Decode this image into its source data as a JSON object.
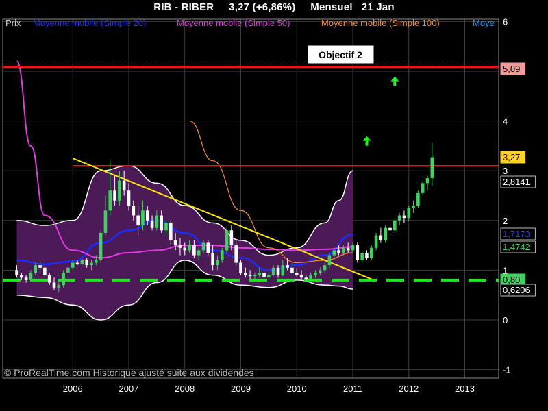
{
  "header": {
    "symbol": "RIB - RIBER",
    "last": "3,27 (+6,86%)",
    "period": "Mensuel",
    "date": "21 Jan"
  },
  "legend": {
    "prix": "Prix",
    "ma20": "Moyenne mobile (Simple 20)",
    "ma50": "Moyenne mobile (Simple 50)",
    "ma100": "Moyenne mobile (Simple 100)",
    "ma_more": "Moye"
  },
  "colors": {
    "background": "#000000",
    "grid": "#3c3c3c",
    "candle_up": "#3ed35e",
    "candle_down": "#ffffff",
    "bollinger_fill": "#4b1a57",
    "bollinger_line": "#ffffff",
    "ma20": "#1a2cff",
    "ma50": "#e43ae4",
    "ma100": "#ff8c1a",
    "trendline": "#ffe600",
    "resistance": "#e01b1b",
    "support": "#22e622",
    "signal_arrow": "#22ee22"
  },
  "annotations": {
    "objective_label": "Objectif 2",
    "objective_level": "5,09",
    "resistance_level": "3,10",
    "support_level": "0,80",
    "watermark": "© ProRealTime.com Historique ajusté suite aux dividendes"
  },
  "price_tags": [
    {
      "text": "5,09",
      "value": 5.09,
      "bg": "#f19a9a",
      "fg": "#000000"
    },
    {
      "text": "3,27",
      "value": 3.27,
      "bg": "#ffd21f",
      "fg": "#000000"
    },
    {
      "text": "2,8141",
      "value": 2.81,
      "bg": "#000000",
      "fg": "#ffffff"
    },
    {
      "text": "1,7173",
      "value": 1.72,
      "bg": "#000000",
      "fg": "#2e3cff"
    },
    {
      "text": "1,4742",
      "value": 1.47,
      "bg": "#000000",
      "fg": "#3ed35e"
    },
    {
      "text": "0,80",
      "value": 0.8,
      "bg": "#3ed35e",
      "fg": "#000000"
    },
    {
      "text": "0,6206",
      "value": 0.62,
      "bg": "#000000",
      "fg": "#ffffff"
    }
  ],
  "chart_data": {
    "type": "candlestick",
    "title": "RIB - RIBER 3,27 (+6,86%) Mensuel 21 Jan",
    "ylim": [
      -1,
      6.2
    ],
    "y_ticks": [
      "-1",
      "0",
      "1",
      "2",
      "3",
      "4",
      "5",
      "6"
    ],
    "y_tick_values": [
      -1,
      0,
      1,
      2,
      3,
      4,
      5,
      6
    ],
    "x_ticks": [
      "2006",
      "2007",
      "2008",
      "2009",
      "2010",
      "2011",
      "2012",
      "2013"
    ],
    "x_start": "2005-01",
    "grid": true,
    "legend_position": "top-left",
    "ohlc": [
      [
        1.0,
        1.1,
        0.85,
        0.9
      ],
      [
        0.9,
        0.95,
        0.8,
        0.85
      ],
      [
        0.85,
        0.9,
        0.75,
        0.8
      ],
      [
        0.8,
        1.0,
        0.78,
        0.95
      ],
      [
        0.95,
        1.15,
        0.9,
        1.1
      ],
      [
        1.1,
        1.2,
        1.0,
        1.05
      ],
      [
        1.05,
        1.1,
        0.85,
        0.9
      ],
      [
        0.9,
        0.95,
        0.7,
        0.75
      ],
      [
        0.75,
        0.85,
        0.6,
        0.65
      ],
      [
        0.65,
        0.75,
        0.55,
        0.7
      ],
      [
        0.7,
        1.0,
        0.65,
        0.95
      ],
      [
        0.95,
        1.1,
        0.9,
        1.05
      ],
      [
        1.05,
        1.2,
        1.0,
        1.15
      ],
      [
        1.15,
        1.2,
        1.1,
        1.12
      ],
      [
        1.12,
        1.25,
        1.1,
        1.2
      ],
      [
        1.2,
        1.25,
        1.05,
        1.1
      ],
      [
        1.1,
        1.2,
        1.0,
        1.15
      ],
      [
        1.15,
        1.3,
        1.1,
        1.2
      ],
      [
        1.2,
        1.8,
        1.15,
        1.75
      ],
      [
        1.75,
        2.5,
        1.7,
        2.2
      ],
      [
        2.2,
        3.2,
        2.1,
        2.6
      ],
      [
        2.6,
        2.9,
        2.3,
        2.4
      ],
      [
        2.4,
        3.0,
        2.3,
        2.8
      ],
      [
        2.8,
        3.0,
        2.5,
        2.6
      ],
      [
        2.6,
        2.75,
        2.2,
        2.3
      ],
      [
        2.3,
        2.4,
        2.0,
        2.1
      ],
      [
        2.1,
        2.3,
        1.7,
        1.9
      ],
      [
        1.9,
        2.4,
        1.8,
        2.2
      ],
      [
        2.2,
        2.3,
        1.9,
        2.0
      ],
      [
        2.0,
        2.1,
        1.8,
        1.85
      ],
      [
        1.85,
        2.2,
        1.8,
        2.1
      ],
      [
        2.1,
        2.2,
        1.75,
        1.8
      ],
      [
        1.8,
        2.0,
        1.7,
        1.95
      ],
      [
        1.95,
        2.0,
        1.5,
        1.6
      ],
      [
        1.6,
        1.75,
        1.4,
        1.5
      ],
      [
        1.5,
        1.65,
        1.3,
        1.45
      ],
      [
        1.45,
        1.55,
        1.3,
        1.4
      ],
      [
        1.4,
        1.6,
        1.35,
        1.5
      ],
      [
        1.5,
        1.6,
        1.25,
        1.3
      ],
      [
        1.3,
        1.45,
        1.2,
        1.4
      ],
      [
        1.4,
        1.6,
        1.35,
        1.55
      ],
      [
        1.55,
        1.6,
        1.3,
        1.35
      ],
      [
        1.35,
        1.5,
        1.0,
        1.1
      ],
      [
        1.1,
        1.3,
        1.0,
        1.2
      ],
      [
        1.2,
        1.45,
        1.15,
        1.4
      ],
      [
        1.4,
        1.85,
        1.35,
        1.8
      ],
      [
        1.8,
        1.9,
        1.4,
        1.5
      ],
      [
        1.5,
        1.6,
        1.1,
        1.15
      ],
      [
        1.15,
        1.2,
        0.9,
        0.95
      ],
      [
        0.95,
        1.05,
        0.85,
        0.9
      ],
      [
        0.9,
        1.0,
        0.82,
        0.88
      ],
      [
        0.88,
        0.95,
        0.82,
        0.9
      ],
      [
        0.9,
        1.05,
        0.85,
        0.95
      ],
      [
        0.95,
        1.0,
        0.82,
        0.86
      ],
      [
        0.86,
        0.95,
        0.8,
        0.9
      ],
      [
        0.9,
        1.1,
        0.88,
        1.05
      ],
      [
        1.05,
        1.1,
        0.85,
        0.9
      ],
      [
        0.9,
        1.2,
        0.88,
        1.1
      ],
      [
        1.1,
        1.25,
        1.0,
        1.05
      ],
      [
        1.05,
        1.15,
        0.9,
        0.95
      ],
      [
        0.95,
        1.05,
        0.85,
        0.9
      ],
      [
        0.9,
        1.0,
        0.82,
        0.85
      ],
      [
        0.85,
        0.9,
        0.78,
        0.82
      ],
      [
        0.82,
        0.95,
        0.8,
        0.9
      ],
      [
        0.9,
        1.0,
        0.85,
        0.95
      ],
      [
        0.95,
        1.05,
        0.9,
        1.0
      ],
      [
        1.0,
        1.15,
        0.95,
        1.1
      ],
      [
        1.1,
        1.35,
        1.05,
        1.3
      ],
      [
        1.3,
        1.45,
        1.25,
        1.4
      ],
      [
        1.4,
        1.5,
        1.3,
        1.35
      ],
      [
        1.35,
        1.5,
        1.3,
        1.45
      ],
      [
        1.45,
        1.55,
        1.35,
        1.4
      ],
      [
        1.4,
        1.55,
        1.35,
        1.5
      ],
      [
        1.5,
        1.55,
        1.15,
        1.2
      ],
      [
        1.2,
        1.4,
        1.15,
        1.35
      ],
      [
        1.35,
        1.4,
        1.2,
        1.25
      ],
      [
        1.25,
        1.5,
        1.2,
        1.45
      ],
      [
        1.45,
        1.75,
        1.4,
        1.7
      ],
      [
        1.7,
        1.85,
        1.55,
        1.6
      ],
      [
        1.6,
        1.9,
        1.55,
        1.85
      ],
      [
        1.85,
        2.0,
        1.75,
        1.8
      ],
      [
        1.8,
        2.05,
        1.75,
        2.0
      ],
      [
        2.0,
        2.15,
        1.9,
        2.1
      ],
      [
        2.1,
        2.2,
        1.95,
        2.05
      ],
      [
        2.05,
        2.3,
        2.0,
        2.25
      ],
      [
        2.25,
        2.4,
        2.15,
        2.3
      ],
      [
        2.3,
        2.6,
        2.25,
        2.55
      ],
      [
        2.55,
        2.8,
        2.5,
        2.75
      ],
      [
        2.75,
        2.9,
        2.6,
        2.85
      ],
      [
        2.85,
        3.55,
        2.7,
        3.27
      ]
    ],
    "series": [
      {
        "name": "Moyenne mobile (Simple 20)",
        "x": [
          "2005-01",
          "2005-07",
          "2006-01",
          "2006-07",
          "2007-01",
          "2007-07",
          "2008-01",
          "2008-07",
          "2009-01",
          "2009-07",
          "2010-01",
          "2010-07",
          "2011-01"
        ],
        "values": [
          1.2,
          1.12,
          1.18,
          1.55,
          1.8,
          2.0,
          1.75,
          1.4,
          1.25,
          1.0,
          1.1,
          1.3,
          1.72
        ]
      },
      {
        "name": "Moyenne mobile (Simple 50)",
        "x": [
          "2005-01",
          "2005-04",
          "2005-07",
          "2006-01",
          "2006-07",
          "2007-01",
          "2007-07",
          "2008-01",
          "2008-07",
          "2009-01",
          "2009-07",
          "2010-01",
          "2010-07",
          "2011-01"
        ],
        "values": [
          5.2,
          3.5,
          2.1,
          1.4,
          1.25,
          1.35,
          1.4,
          1.5,
          1.5,
          1.45,
          1.42,
          1.4,
          1.42,
          1.47
        ]
      },
      {
        "name": "Moyenne mobile (Simple 100)",
        "x": [
          "2008-02",
          "2008-07",
          "2009-01",
          "2009-07",
          "2010-01",
          "2010-07",
          "2011-01"
        ],
        "values": [
          4.0,
          3.2,
          2.2,
          1.45,
          1.15,
          1.2,
          1.35
        ]
      }
    ],
    "bollinger": {
      "x": [
        "2005-01",
        "2005-07",
        "2006-01",
        "2006-07",
        "2007-01",
        "2007-07",
        "2008-01",
        "2008-07",
        "2009-01",
        "2009-07",
        "2010-01",
        "2010-07",
        "2010-10",
        "2011-01"
      ],
      "upper": [
        2.0,
        1.9,
        2.0,
        3.0,
        3.1,
        2.75,
        2.3,
        1.95,
        1.6,
        1.3,
        1.45,
        1.95,
        2.4,
        3.0
      ],
      "lower": [
        0.5,
        0.45,
        0.3,
        0.0,
        0.3,
        0.75,
        1.2,
        0.9,
        0.7,
        0.65,
        0.8,
        0.7,
        0.68,
        0.62
      ]
    },
    "trendline": {
      "x": [
        "2006-01",
        "2011-05"
      ],
      "values": [
        3.25,
        0.82
      ]
    },
    "horizontal_levels": [
      {
        "name": "objectif",
        "value": 5.09
      },
      {
        "name": "resistance",
        "value": 3.1
      },
      {
        "name": "support",
        "value": 0.8
      }
    ],
    "markers": [
      {
        "type": "arrow-up",
        "x": "2011-04",
        "value": 3.6
      },
      {
        "type": "arrow-up",
        "x": "2011-10",
        "value": 4.8
      }
    ]
  }
}
